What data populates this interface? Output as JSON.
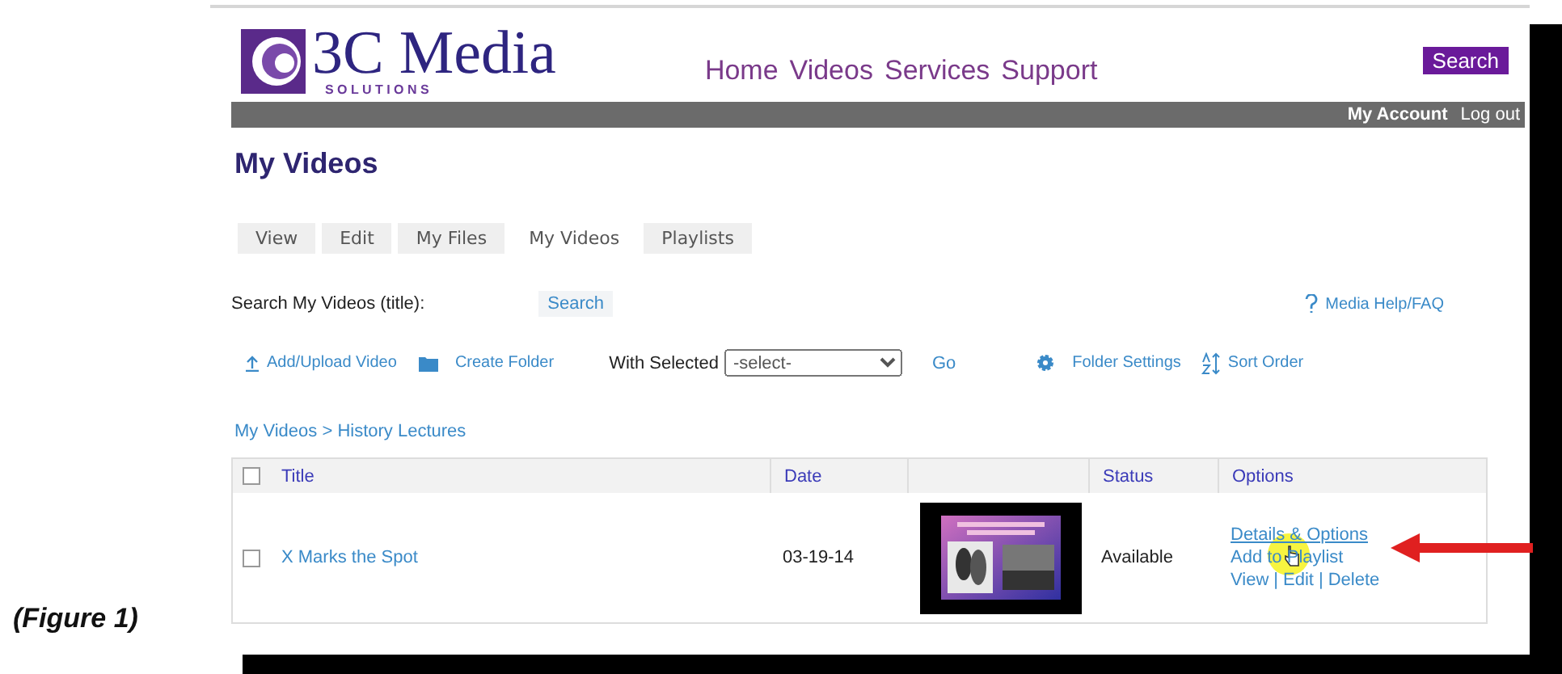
{
  "figure_caption": "(Figure 1)",
  "header": {
    "logo": {
      "name": "3C Media",
      "tagline": "S O L U T I O N S"
    },
    "nav": [
      "Home",
      "Videos",
      "Services",
      "Support"
    ],
    "search_button": "Search"
  },
  "account_bar": [
    "My Account",
    "Log out"
  ],
  "page_title": "My Videos",
  "tabs": [
    {
      "label": "View",
      "selected": false
    },
    {
      "label": "Edit",
      "selected": false
    },
    {
      "label": "My Files",
      "selected": false
    },
    {
      "label": "My Videos",
      "selected": true
    },
    {
      "label": "Playlists",
      "selected": false
    }
  ],
  "search": {
    "label": "Search My Videos (title):",
    "button": "Search"
  },
  "help_link": "Media Help/FAQ",
  "toolbar": {
    "add_upload": "Add/Upload Video",
    "create_folder": "Create Folder",
    "with_selected": "With Selected",
    "select_value": "-select-",
    "go": "Go",
    "folder_settings": "Folder Settings",
    "sort_order": "Sort Order"
  },
  "breadcrumb": {
    "items": [
      "My Videos",
      "History Lectures"
    ],
    "separator": ">"
  },
  "table": {
    "header_checked": false,
    "columns": [
      {
        "kind": "text",
        "label": "Title"
      },
      {
        "kind": "text",
        "label": "Date"
      },
      {
        "kind": "thumbnail"
      },
      {
        "kind": "text",
        "label": "Status"
      },
      {
        "kind": "text",
        "label": "Options"
      }
    ],
    "rows": [
      {
        "checked": false,
        "title": "X Marks the Spot",
        "date": "03-19-14",
        "thumbnail": {
          "kind": "picture"
        },
        "status": "Available",
        "options": [
          {
            "kind": "link",
            "label": "Details & Options"
          },
          {
            "kind": "link",
            "label": "Add to Playlist"
          },
          {
            "kind": "links",
            "items": [
              "View",
              "Edit",
              "Delete"
            ],
            "separator": "|"
          }
        ]
      }
    ]
  },
  "annotations": {
    "highlight": true,
    "arrow": true
  }
}
